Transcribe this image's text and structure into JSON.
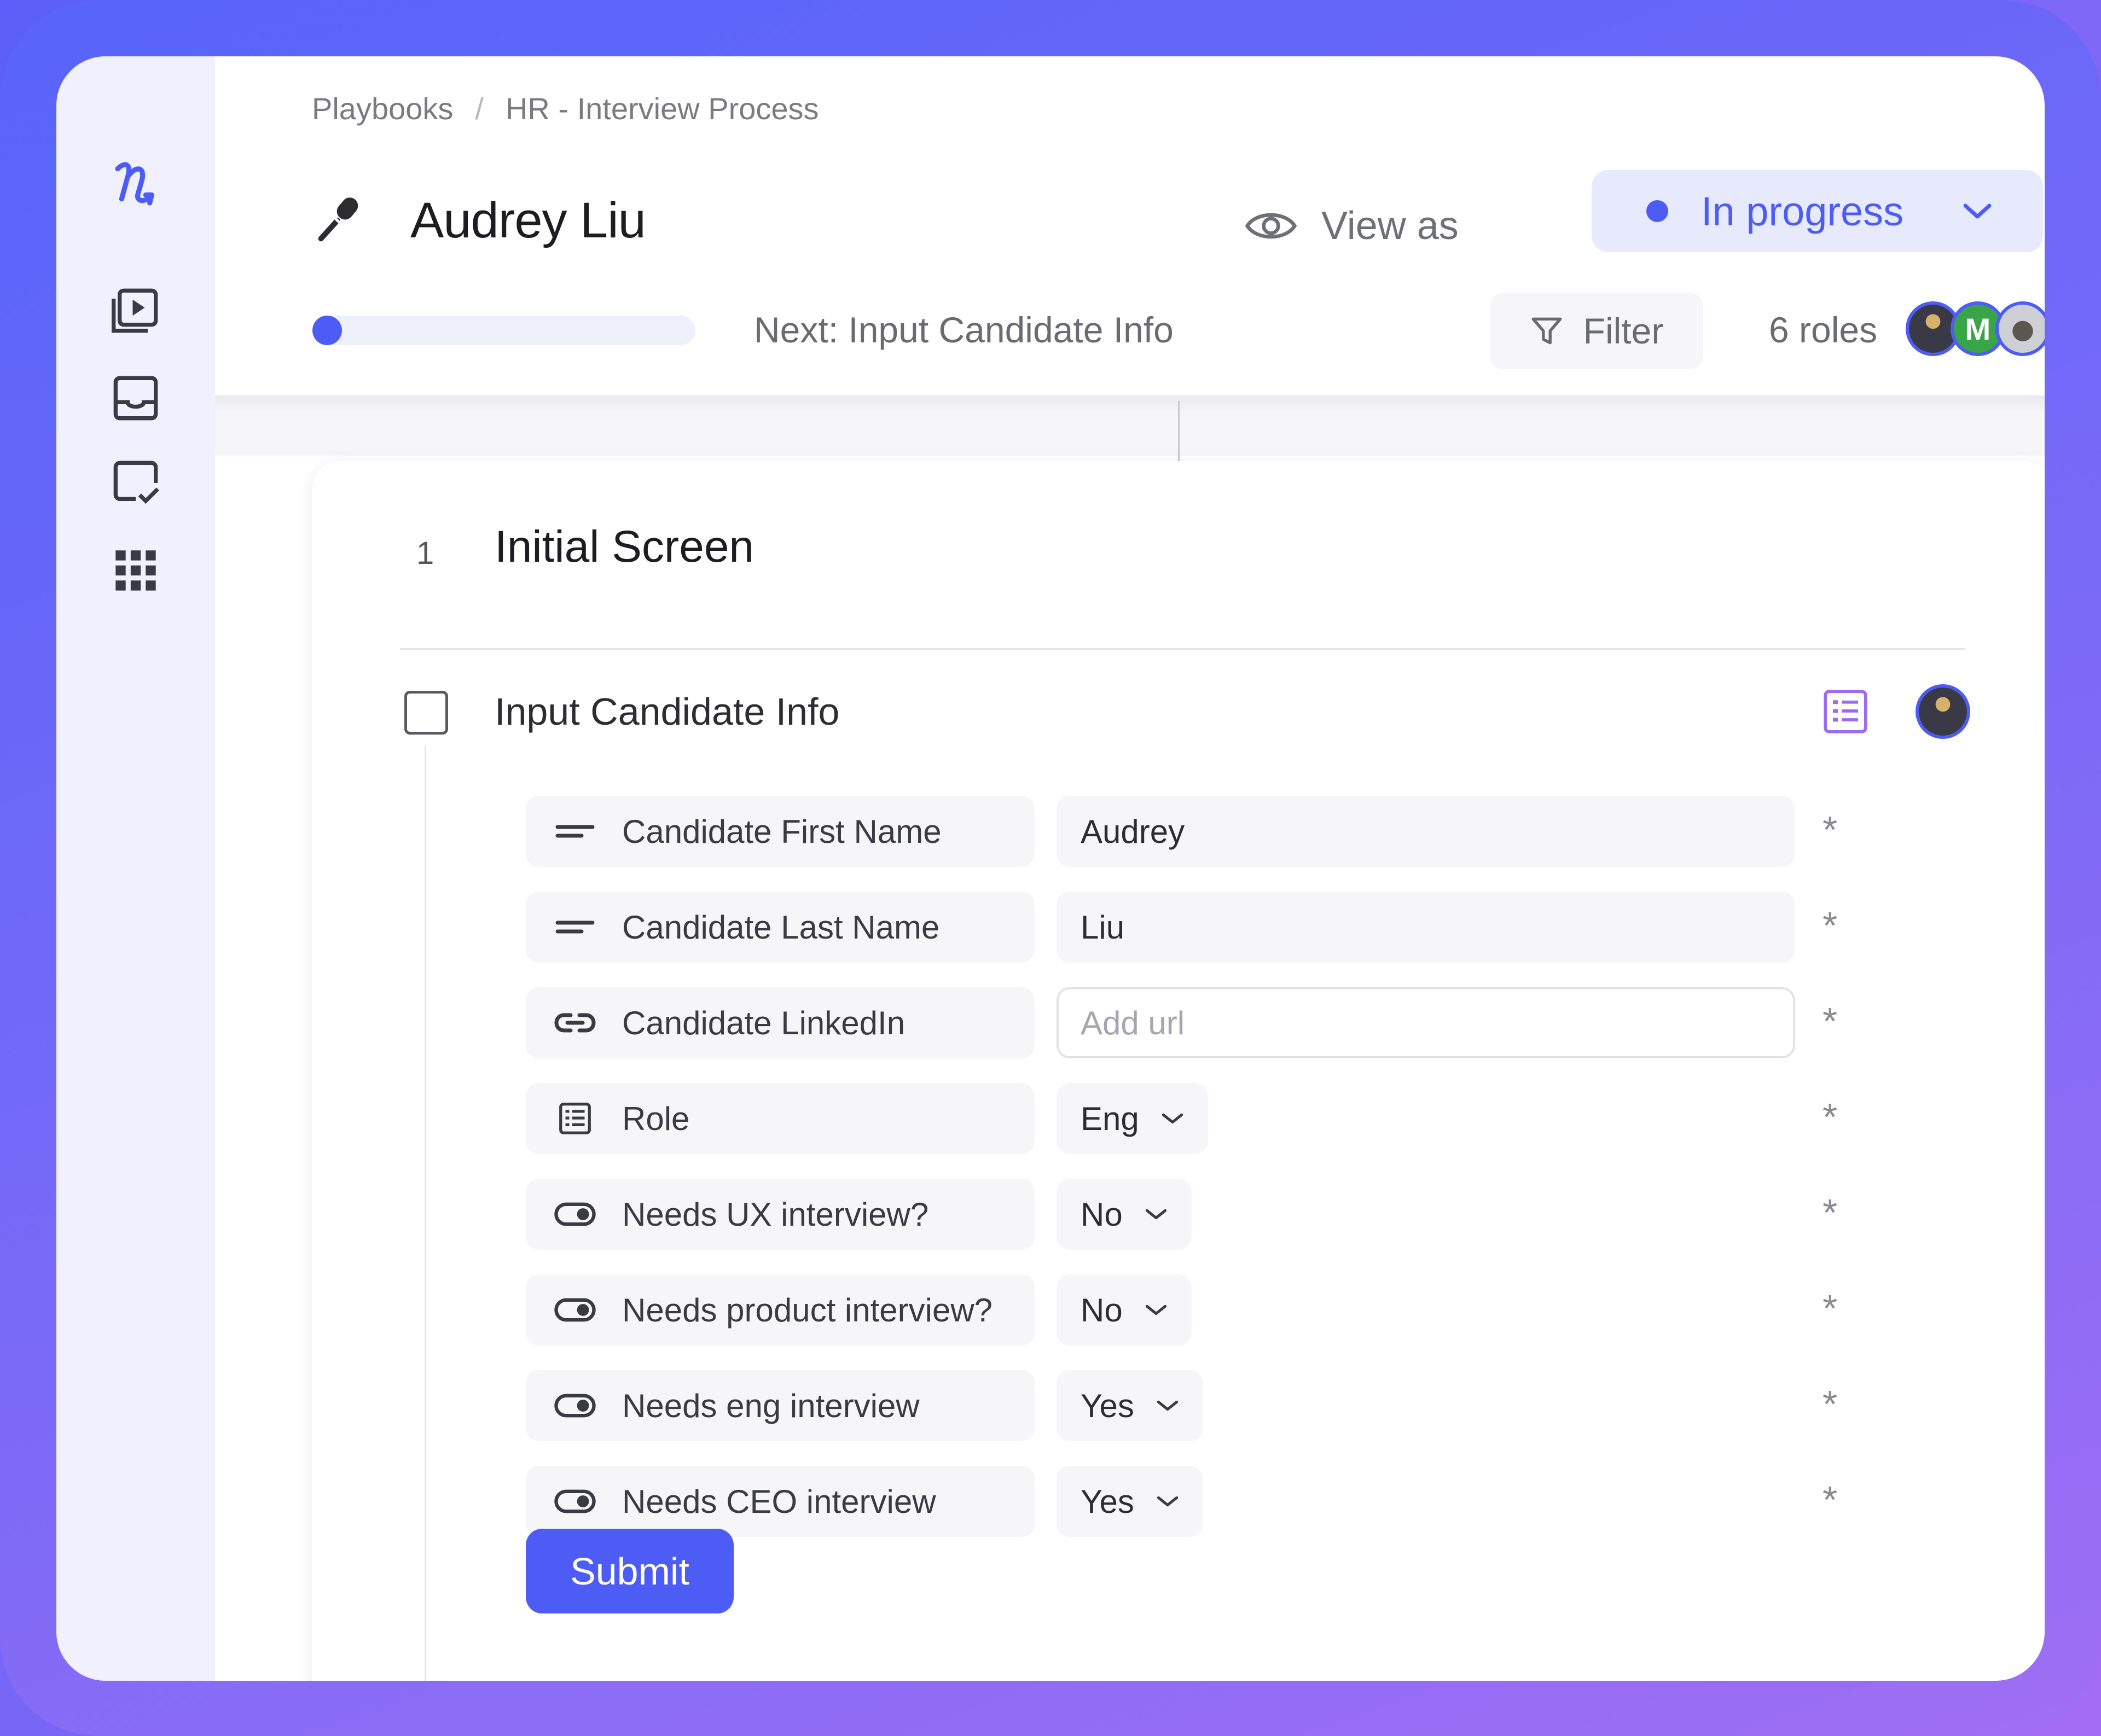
{
  "breadcrumb": {
    "root": "Playbooks",
    "separator": "/",
    "current": "HR - Interview Process"
  },
  "header": {
    "title": "Audrey Liu",
    "view_as_label": "View as",
    "status_label": "In progress"
  },
  "progress": {
    "percent": 4,
    "next_label": "Next: Input Candidate Info"
  },
  "toolbar": {
    "filter_label": "Filter",
    "roles_label": "6 roles"
  },
  "avatars": [
    {
      "initial": ""
    },
    {
      "initial": "M"
    },
    {
      "initial": ""
    }
  ],
  "section": {
    "number": "1",
    "title": "Initial Screen"
  },
  "task": {
    "title": "Input Candidate Info"
  },
  "fields": [
    {
      "label": "Candidate First Name",
      "value": "Audrey",
      "icon": "short-text-icon",
      "required": "*"
    },
    {
      "label": "Candidate Last Name",
      "value": "Liu",
      "icon": "short-text-icon",
      "required": "*"
    },
    {
      "label": "Candidate LinkedIn",
      "placeholder": "Add url",
      "icon": "link-icon",
      "required": "*"
    },
    {
      "label": "Role",
      "value": "Eng",
      "icon": "list-icon",
      "required": "*"
    },
    {
      "label": "Needs UX interview?",
      "value": "No",
      "icon": "toggle-icon",
      "required": "*"
    },
    {
      "label": "Needs product interview?",
      "value": "No",
      "icon": "toggle-icon",
      "required": "*"
    },
    {
      "label": "Needs eng interview",
      "value": "Yes",
      "icon": "toggle-icon",
      "required": "*"
    },
    {
      "label": "Needs CEO interview",
      "value": "Yes",
      "icon": "toggle-icon",
      "required": "*"
    }
  ],
  "submit_label": "Submit",
  "colors": {
    "accent": "#4c5cf4",
    "sidebar_bg": "#f1f0fe",
    "status_bg": "#e7eafd",
    "frame": "#6a66f8"
  }
}
